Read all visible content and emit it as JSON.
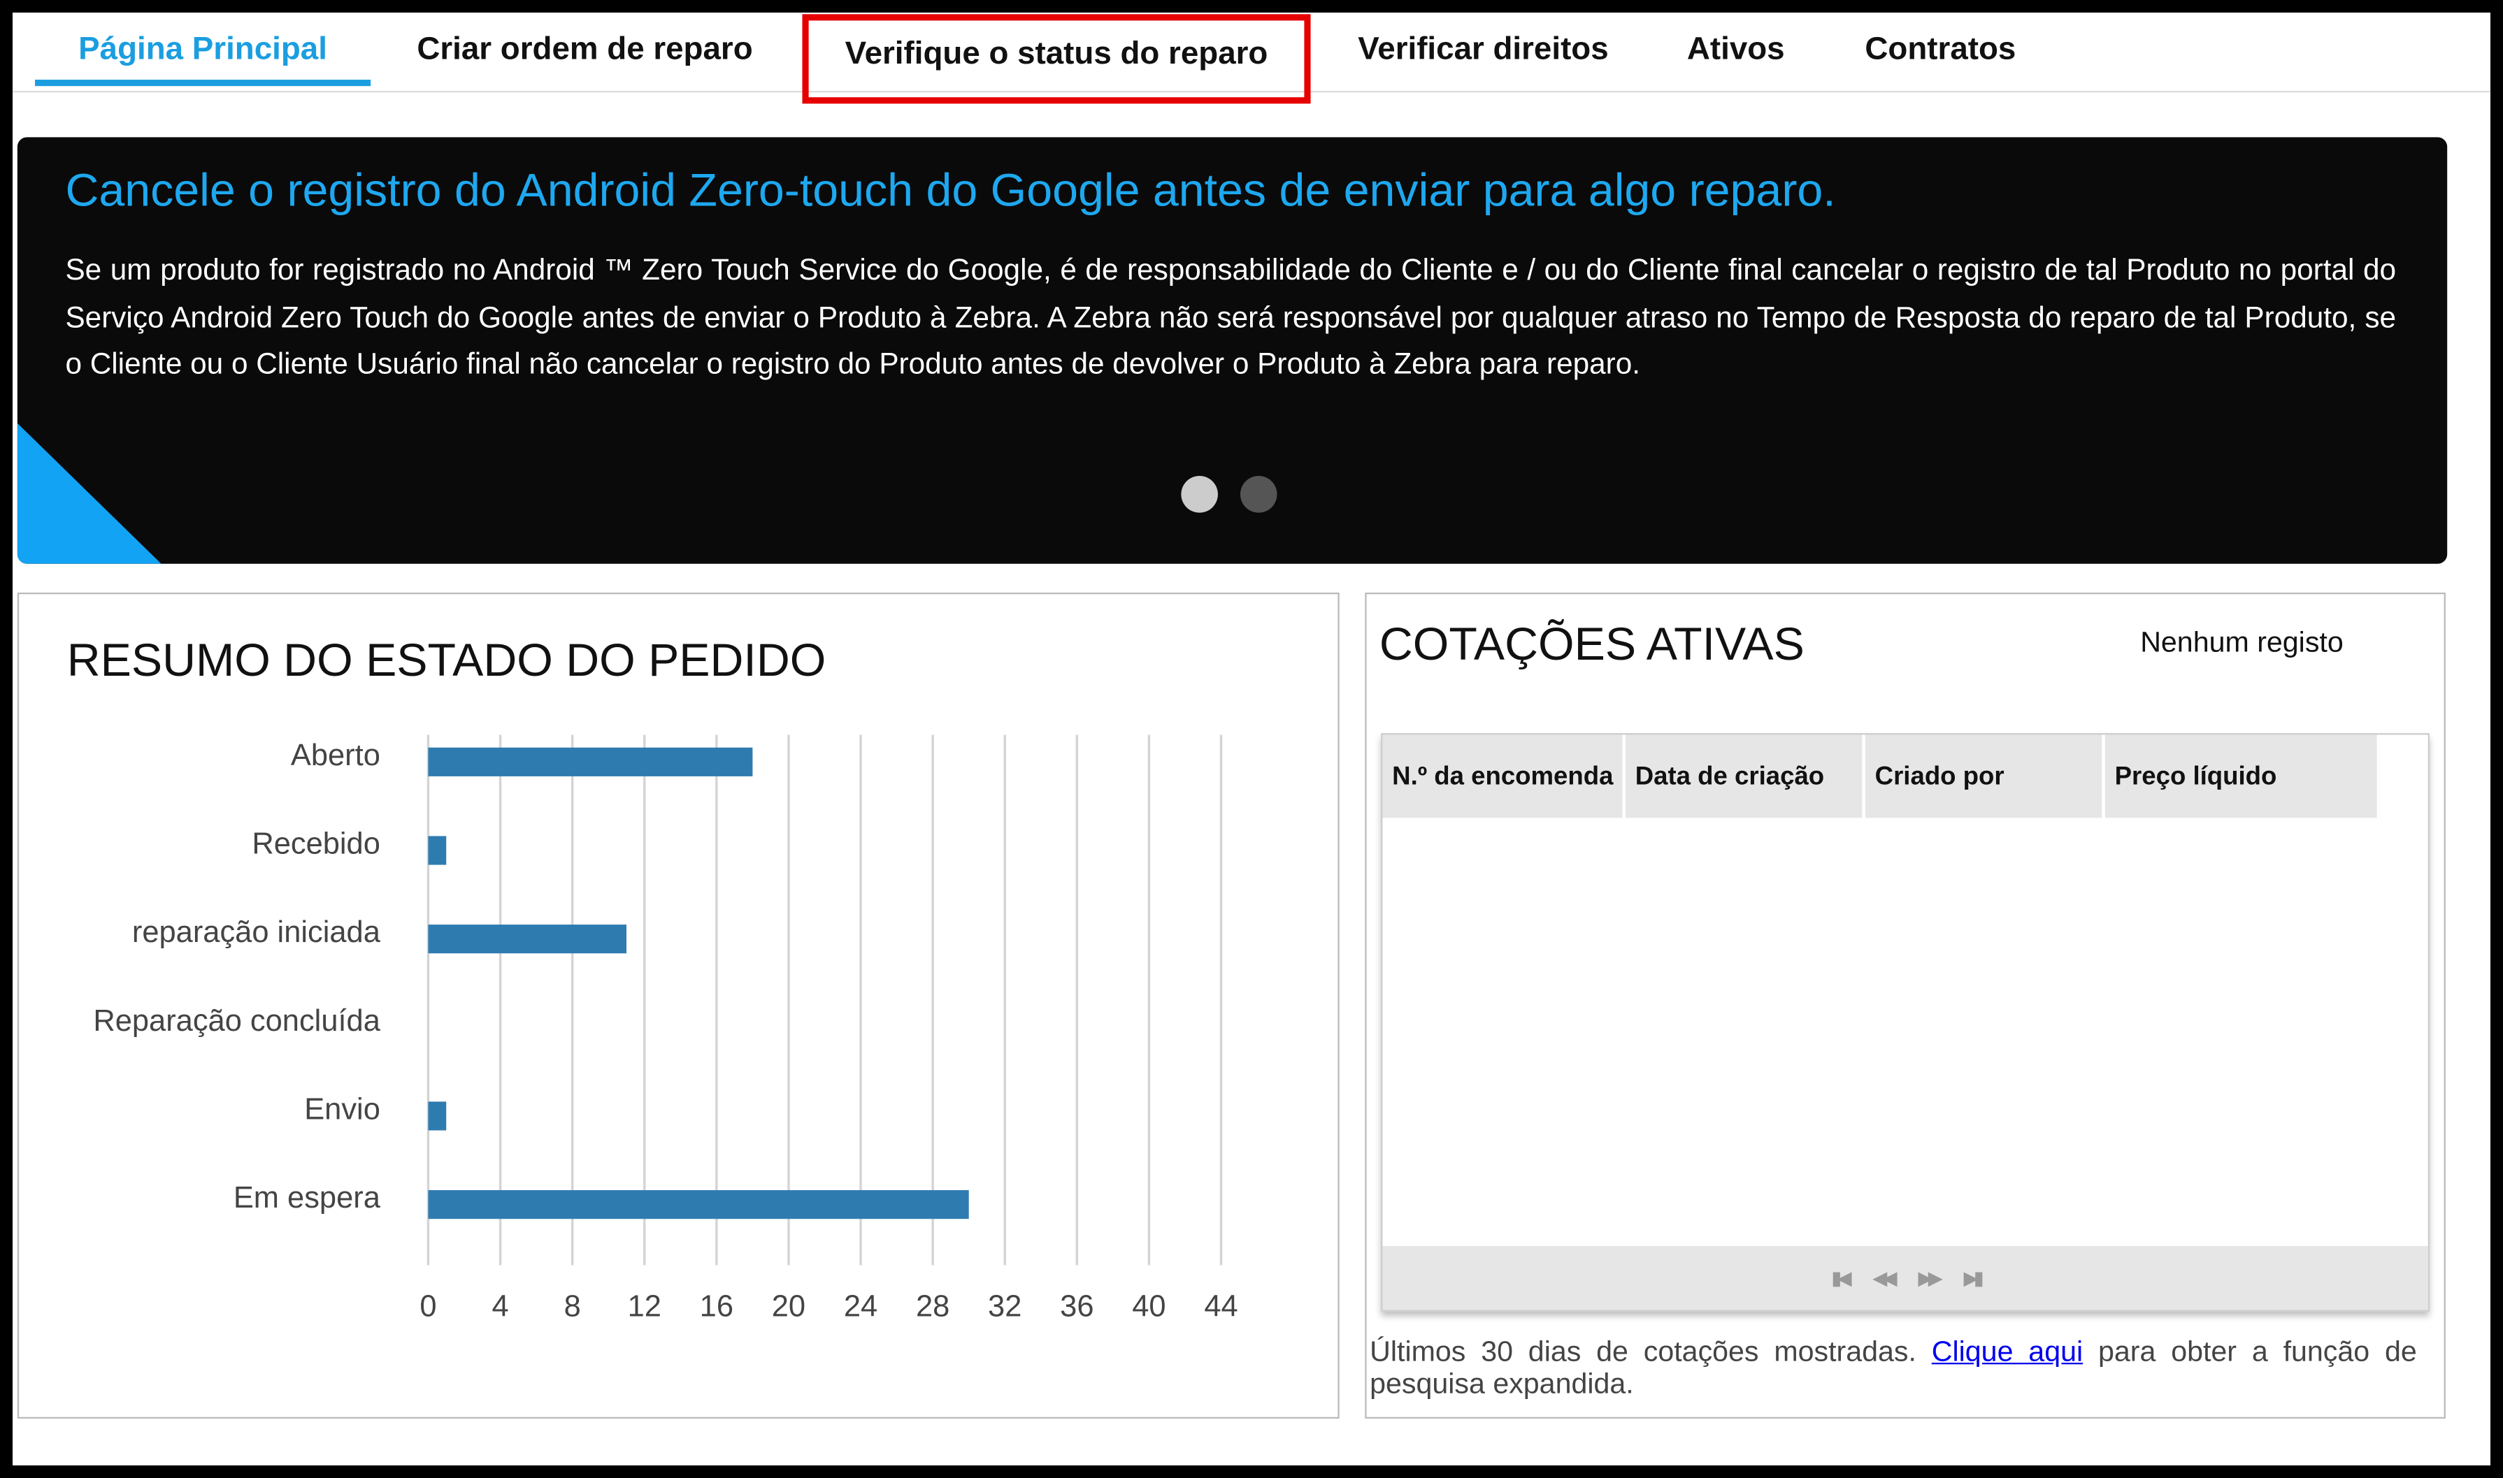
{
  "tabs": [
    {
      "label": "Página Principal",
      "active": true
    },
    {
      "label": "Criar ordem de reparo"
    },
    {
      "label": "Verifique o status do reparo",
      "highlighted": true
    },
    {
      "label": "Verificar direitos"
    },
    {
      "label": "Ativos"
    },
    {
      "label": "Contratos"
    }
  ],
  "banner": {
    "title": "Cancele o registro do Android Zero-touch do Google antes de enviar para algo reparo.",
    "text": "Se um produto for registrado no Android ™ Zero Touch Service do Google, é de responsabilidade do Cliente e / ou do Cliente final cancelar o registro de tal Produto no portal do Serviço Android Zero Touch do Google antes de enviar o Produto à Zebra. A Zebra não será responsável por qualquer atraso no Tempo de Resposta do reparo de tal Produto, se o Cliente ou o Cliente Usuário final não cancelar o registro do Produto antes de devolver o Produto à Zebra para reparo.",
    "slides": 2,
    "active_slide": 0
  },
  "summary": {
    "title": "RESUMO DO ESTADO DO PEDIDO"
  },
  "chart_data": {
    "type": "bar",
    "orientation": "horizontal",
    "title": "RESUMO DO ESTADO DO PEDIDO",
    "categories": [
      "Aberto",
      "Recebido",
      "reparação iniciada",
      "Reparação concluída",
      "Envio",
      "Em espera"
    ],
    "values": [
      18,
      1,
      11,
      0,
      1,
      30
    ],
    "xlim": [
      0,
      44
    ],
    "xticks": [
      "0",
      "4",
      "8",
      "12",
      "16",
      "20",
      "24",
      "28",
      "32",
      "36",
      "40",
      "44"
    ],
    "grid": true,
    "bar_color": "#2e7bb0"
  },
  "quotes": {
    "title": "COTAÇÕES ATIVAS",
    "no_record": "Nenhum registo",
    "columns": [
      "N.º da encomenda",
      "Data de criação",
      "Criado por",
      "Preço líquido"
    ],
    "rows": [],
    "pager_icons": [
      "first-page-icon",
      "prev-page-icon",
      "next-page-icon",
      "last-page-icon"
    ],
    "footer_before": "Últimos 30 dias de cotações mostradas. ",
    "footer_link": "Clique aqui",
    "footer_after": " para obter a função de pesquisa expandida."
  },
  "colors": {
    "accent": "#1b9ee0",
    "highlight_box": "#e60000",
    "banner_bg": "#0a0a0a",
    "banner_title": "#1ea8f0"
  }
}
